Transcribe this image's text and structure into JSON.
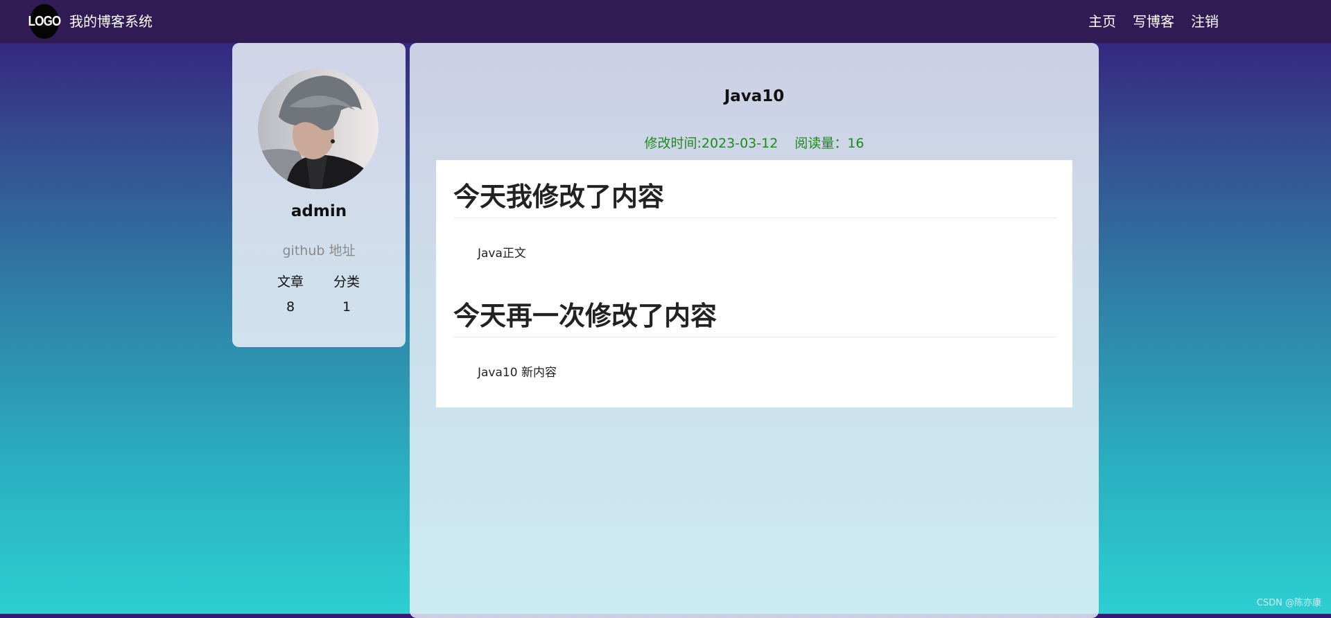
{
  "nav": {
    "logo_text": "LOGO",
    "site_title": "我的博客系统",
    "links": [
      "主页",
      "写博客",
      "注销"
    ]
  },
  "profile": {
    "username": "admin",
    "github_label": "github 地址",
    "stats": {
      "articles_label": "文章",
      "categories_label": "分类",
      "articles_count": "8",
      "categories_count": "1"
    }
  },
  "article": {
    "title": "Java10",
    "modified_time": "修改时间:2023-03-12",
    "read_count": "阅读量：16",
    "sections": [
      {
        "heading": "今天我修改了内容",
        "body": "Java正文"
      },
      {
        "heading": "今天再一次修改了内容",
        "body": "Java10 新内容"
      }
    ]
  },
  "watermark": "CSDN @陈亦康"
}
